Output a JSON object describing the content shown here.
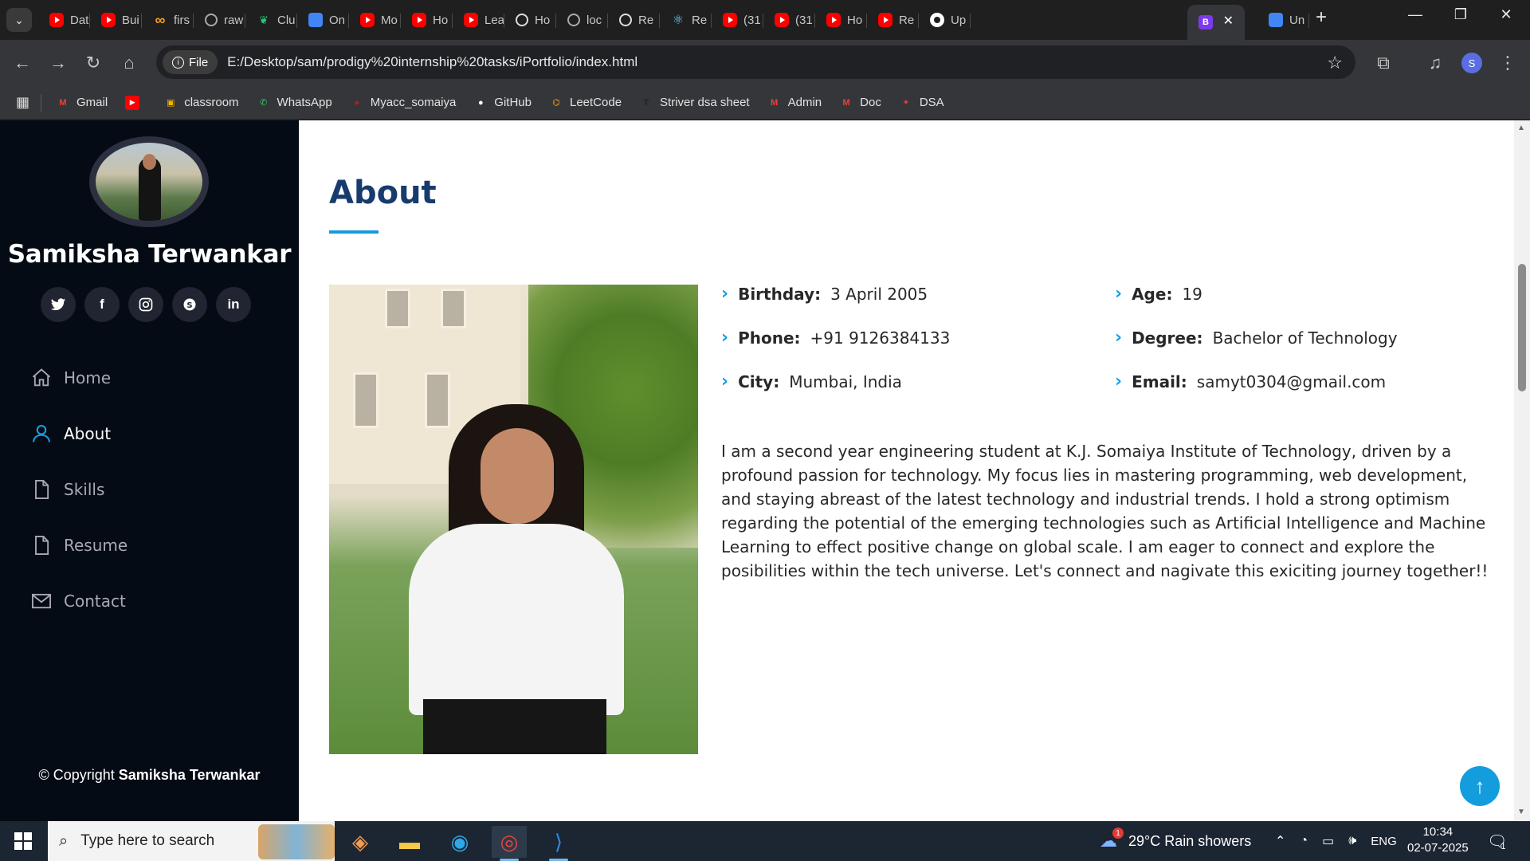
{
  "browser": {
    "tabs": [
      {
        "label": "Dat",
        "icon": "youtube-icon"
      },
      {
        "label": "Bui",
        "icon": "youtube-icon"
      },
      {
        "label": "firs",
        "icon": "infinity-icon"
      },
      {
        "label": "raw",
        "icon": "globe-icon"
      },
      {
        "label": "Clu",
        "icon": "leaf-icon"
      },
      {
        "label": "On",
        "icon": "doc-icon"
      },
      {
        "label": "Mo",
        "icon": "youtube-icon"
      },
      {
        "label": "Ho",
        "icon": "youtube-icon"
      },
      {
        "label": "Lea",
        "icon": "youtube-icon"
      },
      {
        "label": "Ho",
        "icon": "openai-icon"
      },
      {
        "label": "loc",
        "icon": "globe-icon"
      },
      {
        "label": "Re",
        "icon": "openai-icon"
      },
      {
        "label": "Re",
        "icon": "react-icon"
      },
      {
        "label": "(31",
        "icon": "youtube-icon"
      },
      {
        "label": "(31",
        "icon": "youtube-icon"
      },
      {
        "label": "Ho",
        "icon": "youtube-icon"
      },
      {
        "label": "Re",
        "icon": "youtube-icon"
      },
      {
        "label": "Up",
        "icon": "github-icon"
      },
      {
        "label": "B",
        "icon": "b-icon"
      },
      {
        "label": "Un",
        "icon": "doc-icon"
      }
    ],
    "chip_label": "File",
    "url": "E:/Desktop/sam/prodigy%20internship%20tasks/iPortfolio/index.html",
    "profile_initial": "S",
    "bookmarks": [
      {
        "label": "Gmail",
        "icon": "gmail-icon"
      },
      {
        "label": "",
        "icon": "youtube-icon"
      },
      {
        "label": "classroom",
        "icon": "classroom-icon"
      },
      {
        "label": "WhatsApp",
        "icon": "whatsapp-icon"
      },
      {
        "label": "Myacc_somaiya",
        "icon": "somaiya-icon"
      },
      {
        "label": "GitHub",
        "icon": "github-icon"
      },
      {
        "label": "LeetCode",
        "icon": "leetcode-icon"
      },
      {
        "label": "Striver dsa sheet",
        "icon": "tuf-icon"
      },
      {
        "label": "Admin",
        "icon": "gmail-icon"
      },
      {
        "label": "Doc",
        "icon": "gmail-icon"
      },
      {
        "label": "DSA",
        "icon": "medal-icon"
      }
    ]
  },
  "sidebar": {
    "name": "Samiksha Terwankar",
    "socials": [
      "twitter",
      "facebook",
      "instagram",
      "skype",
      "linkedin"
    ],
    "nav": [
      {
        "label": "Home",
        "icon": "home-icon"
      },
      {
        "label": "About",
        "icon": "user-icon",
        "active": true
      },
      {
        "label": "Skills",
        "icon": "file-icon"
      },
      {
        "label": "Resume",
        "icon": "file-icon"
      },
      {
        "label": "Contact",
        "icon": "envelope-icon"
      }
    ],
    "copyright_prefix": "© Copyright",
    "copyright_name": "Samiksha Terwankar"
  },
  "about": {
    "title": "About",
    "facts": [
      {
        "label": "Birthday:",
        "value": "3 April 2005"
      },
      {
        "label": "Age:",
        "value": "19"
      },
      {
        "label": "Phone:",
        "value": "+91 9126384133"
      },
      {
        "label": "Degree:",
        "value": "Bachelor of Technology"
      },
      {
        "label": "City:",
        "value": "Mumbai, India"
      },
      {
        "label": "Email:",
        "value": "samyt0304@gmail.com"
      }
    ],
    "description": "I am a second year engineering student at K.J. Somaiya Institute of Technology, driven by a profound passion for technology. My focus lies in mastering programming, web development, and staying abreast of the latest technology and industrial trends. I hold a strong optimism regarding the potential of the emerging technologies such as Artificial Intelligence and Machine Learning to effect positive change on global scale. I am eager to connect and explore the posibilities within the tech universe. Let's connect and nagivate this exiciting journey together!!"
  },
  "taskbar": {
    "search_placeholder": "Type here to search",
    "weather": "29°C  Rain showers",
    "weather_badge": "1",
    "language": "ENG",
    "time": "10:34",
    "date": "02-07-2025",
    "notification_count": "1"
  },
  "colors": {
    "accent": "#149ddd",
    "sidebar_bg": "#040b14",
    "title": "#173b6c"
  }
}
